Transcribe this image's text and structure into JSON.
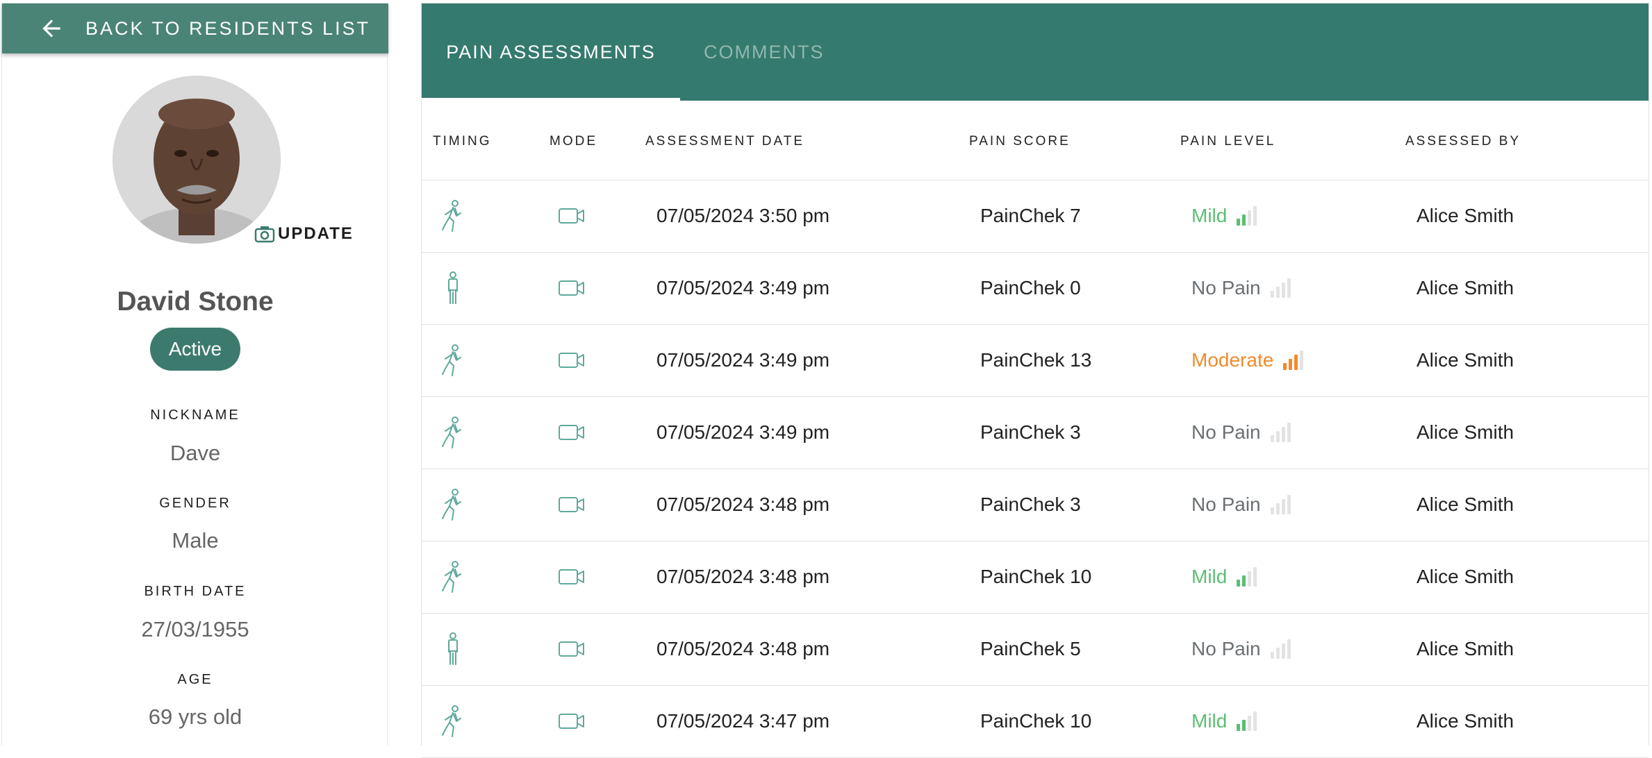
{
  "sidebar": {
    "back_label": "BACK TO RESIDENTS LIST",
    "update_label": "UPDATE",
    "resident": {
      "name": "David Stone",
      "status": "Active",
      "fields": [
        {
          "label": "NICKNAME",
          "value": "Dave"
        },
        {
          "label": "GENDER",
          "value": "Male"
        },
        {
          "label": "BIRTH DATE",
          "value": "27/03/1955"
        },
        {
          "label": "AGE",
          "value": "69 yrs old"
        }
      ]
    }
  },
  "tabs": [
    {
      "label": "PAIN ASSESSMENTS",
      "active": true
    },
    {
      "label": "COMMENTS",
      "active": false
    }
  ],
  "table": {
    "columns": [
      "TIMING",
      "MODE",
      "ASSESSMENT DATE",
      "PAIN SCORE",
      "PAIN LEVEL",
      "ASSESSED BY"
    ],
    "rows": [
      {
        "timing_icon": "walking-person-icon",
        "mode_icon": "video-camera-icon",
        "date": "07/05/2024 3:50 pm",
        "score": "PainChek 7",
        "level": "Mild",
        "level_bars": 2,
        "by": "Alice Smith"
      },
      {
        "timing_icon": "standing-person-icon",
        "mode_icon": "video-camera-icon",
        "date": "07/05/2024 3:49 pm",
        "score": "PainChek 0",
        "level": "No Pain",
        "level_bars": 0,
        "by": "Alice Smith"
      },
      {
        "timing_icon": "walking-person-icon",
        "mode_icon": "video-camera-icon",
        "date": "07/05/2024 3:49 pm",
        "score": "PainChek 13",
        "level": "Moderate",
        "level_bars": 3,
        "by": "Alice Smith"
      },
      {
        "timing_icon": "walking-person-icon",
        "mode_icon": "video-camera-icon",
        "date": "07/05/2024 3:49 pm",
        "score": "PainChek 3",
        "level": "No Pain",
        "level_bars": 0,
        "by": "Alice Smith"
      },
      {
        "timing_icon": "walking-person-icon",
        "mode_icon": "video-camera-icon",
        "date": "07/05/2024 3:48 pm",
        "score": "PainChek 3",
        "level": "No Pain",
        "level_bars": 0,
        "by": "Alice Smith"
      },
      {
        "timing_icon": "walking-person-icon",
        "mode_icon": "video-camera-icon",
        "date": "07/05/2024 3:48 pm",
        "score": "PainChek 10",
        "level": "Mild",
        "level_bars": 2,
        "by": "Alice Smith"
      },
      {
        "timing_icon": "standing-person-icon",
        "mode_icon": "video-camera-icon",
        "date": "07/05/2024 3:48 pm",
        "score": "PainChek 5",
        "level": "No Pain",
        "level_bars": 0,
        "by": "Alice Smith"
      },
      {
        "timing_icon": "walking-person-icon",
        "mode_icon": "video-camera-icon",
        "date": "07/05/2024 3:47 pm",
        "score": "PainChek 10",
        "level": "Mild",
        "level_bars": 2,
        "by": "Alice Smith"
      }
    ]
  },
  "colors": {
    "primary": "#357a6e",
    "mild": "#5bbf72",
    "moderate": "#ef8b2c",
    "no_pain": "#6a6f73"
  }
}
